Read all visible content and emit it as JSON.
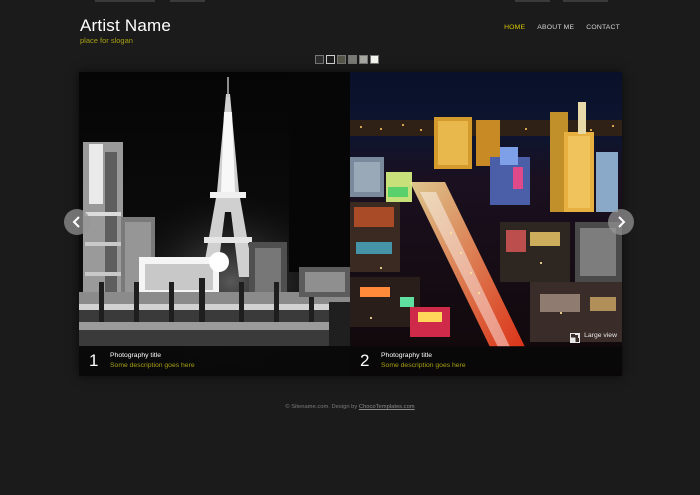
{
  "header": {
    "artist_name": "Artist Name",
    "slogan": "place for slogan"
  },
  "nav": {
    "items": [
      {
        "label": "HOME",
        "active": true
      },
      {
        "label": "ABOUT ME",
        "active": false
      },
      {
        "label": "CONTACT",
        "active": false
      }
    ]
  },
  "swatches": [
    "#2d2d2d",
    "#1f1f1f",
    "#555547",
    "#7a7a74",
    "#a8a8a2",
    "#f4f4ee"
  ],
  "slides": [
    {
      "number": "1",
      "title": "Photography title",
      "description": "Some description goes here"
    },
    {
      "number": "2",
      "title": "Photography title",
      "description": "Some description goes here"
    }
  ],
  "large_view_label": "Large view",
  "icons": {
    "prev": "chevron-left-icon",
    "next": "chevron-right-icon",
    "large_view": "enlarge-icon"
  },
  "footer": {
    "prefix": "© Sitename.com. Design by ",
    "link_text": "ChocoTemplates.com"
  },
  "colors": {
    "background": "#1b1b1b",
    "accent": "#d6c800",
    "slogan": "#a7a012"
  }
}
